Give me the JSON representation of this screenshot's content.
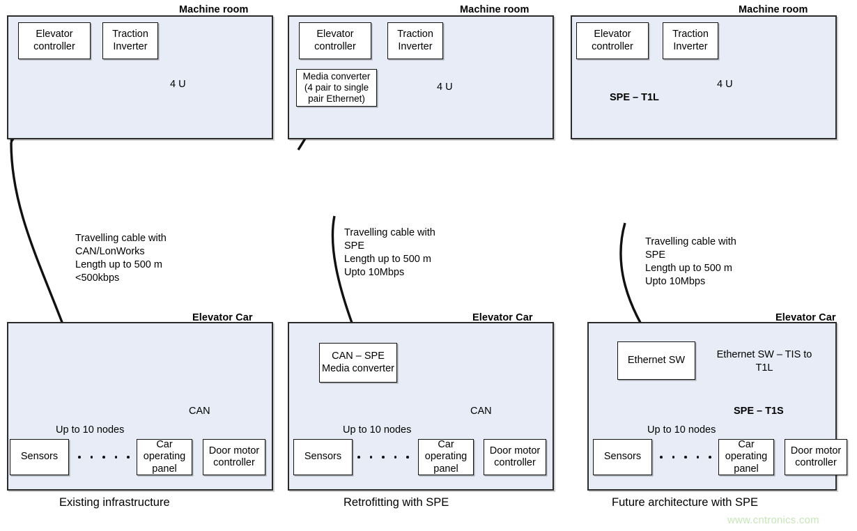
{
  "diagram": {
    "title_watermark": "www.cntronics.com",
    "columns": [
      {
        "id": "existing",
        "caption": "Existing infrastructure",
        "machine_room": {
          "title": "Machine room",
          "boxes": [
            {
              "name": "elevator-controller",
              "label": "Elevator\ncontroller"
            },
            {
              "name": "traction-inverter",
              "label": "Traction\nInverter"
            }
          ],
          "rack_label": "4 U",
          "bus_label": ""
        },
        "cable_note": "Travelling cable with\nCAN/LonWorks\nLength up to 500 m\n<500kbps",
        "elevator_car": {
          "title": "Elevator Car",
          "converter": null,
          "converter_note": null,
          "bus_label": "CAN",
          "nodes_label": "Up to 10 nodes",
          "devices": [
            {
              "name": "sensors",
              "label": "Sensors"
            },
            {
              "name": "car-operating-panel",
              "label": "Car\noperating\npanel"
            },
            {
              "name": "door-motor-controller",
              "label": "Door\nmotor\ncontroller"
            }
          ],
          "dot_count": 5
        }
      },
      {
        "id": "retrofit",
        "caption": "Retrofitting with SPE",
        "machine_room": {
          "title": "Machine room",
          "boxes": [
            {
              "name": "elevator-controller",
              "label": "Elevator\ncontroller"
            },
            {
              "name": "traction-inverter",
              "label": "Traction\nInverter"
            }
          ],
          "converter": "Media converter\n(4 pair to single\npair Ethernet)",
          "rack_label": "4 U",
          "bus_label": ""
        },
        "cable_note": "Travelling cable with\nSPE\nLength up to 500 m\nUpto 10Mbps",
        "elevator_car": {
          "title": "Elevator Car",
          "converter": "CAN – SPE\nMedia converter",
          "converter_note": null,
          "bus_label": "CAN",
          "nodes_label": "Up to 10 nodes",
          "devices": [
            {
              "name": "sensors",
              "label": "Sensors"
            },
            {
              "name": "car-operating-panel",
              "label": "Car\noperating\npanel"
            },
            {
              "name": "door-motor-controller",
              "label": "Door\nmotor\ncontroller"
            }
          ],
          "dot_count": 5
        }
      },
      {
        "id": "future",
        "caption": "Future architecture with SPE",
        "machine_room": {
          "title": "Machine room",
          "boxes": [
            {
              "name": "elevator-controller",
              "label": "Elevator\ncontroller"
            },
            {
              "name": "traction-inverter",
              "label": "Traction\nInverter"
            }
          ],
          "link_label": "SPE – T1L",
          "rack_label": "4 U",
          "bus_label": ""
        },
        "cable_note": "Travelling cable with\nSPE\nLength up to 500 m\nUpto 10Mbps",
        "elevator_car": {
          "title": "Elevator Car",
          "converter": "Ethernet SW",
          "converter_note": "Ethernet SW – TIS to\nT1L",
          "bus_label": "SPE – T1S",
          "nodes_label": "Up to 10 nodes",
          "devices": [
            {
              "name": "sensors",
              "label": "Sensors"
            },
            {
              "name": "car-operating-panel",
              "label": "Car\noperating\npanel"
            },
            {
              "name": "door-motor-controller",
              "label": "Door\nmotor\ncontroller"
            }
          ],
          "dot_count": 5
        }
      }
    ],
    "colors": {
      "panel_fill": "#e7ecf6",
      "panel_stroke": "#2b2b2b",
      "box_fill": "#ffffff",
      "box_stroke": "#121212",
      "watermark": "#c7e6b8"
    }
  }
}
